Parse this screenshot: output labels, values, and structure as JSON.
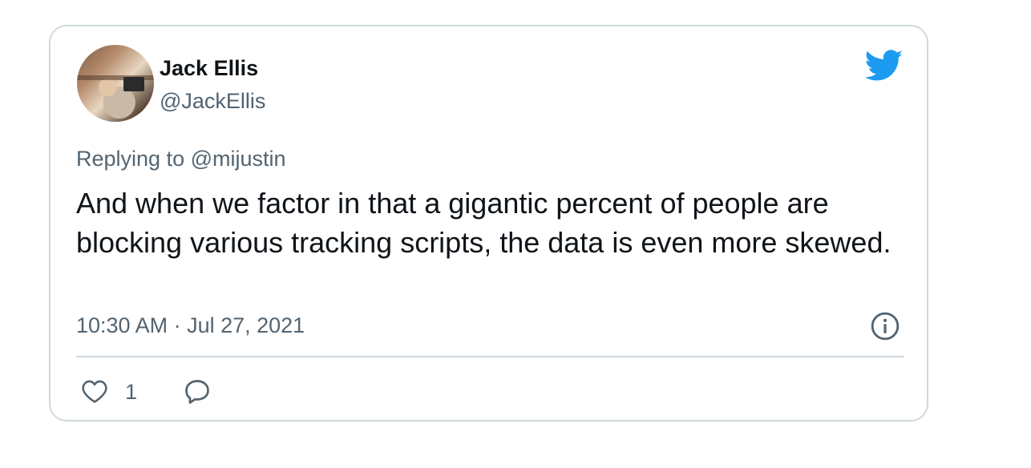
{
  "author": {
    "name": "Jack Ellis",
    "handle": "@JackEllis"
  },
  "reply_prefix": "Replying to ",
  "reply_to": "@mijustin",
  "tweet_text": "And when we factor in that a gigantic percent of people are blocking various tracking scripts, the data is even more skewed.",
  "timestamp": "10:30 AM · Jul 27, 2021",
  "actions": {
    "like_count": "1"
  },
  "colors": {
    "brand": "#1d9bf0",
    "text": "#0f1419",
    "secondary": "#536471",
    "border": "#cfd9de"
  },
  "icons": {
    "brand": "twitter-bird-icon",
    "info": "info-icon",
    "like": "heart-icon",
    "reply": "speech-bubble-icon"
  }
}
